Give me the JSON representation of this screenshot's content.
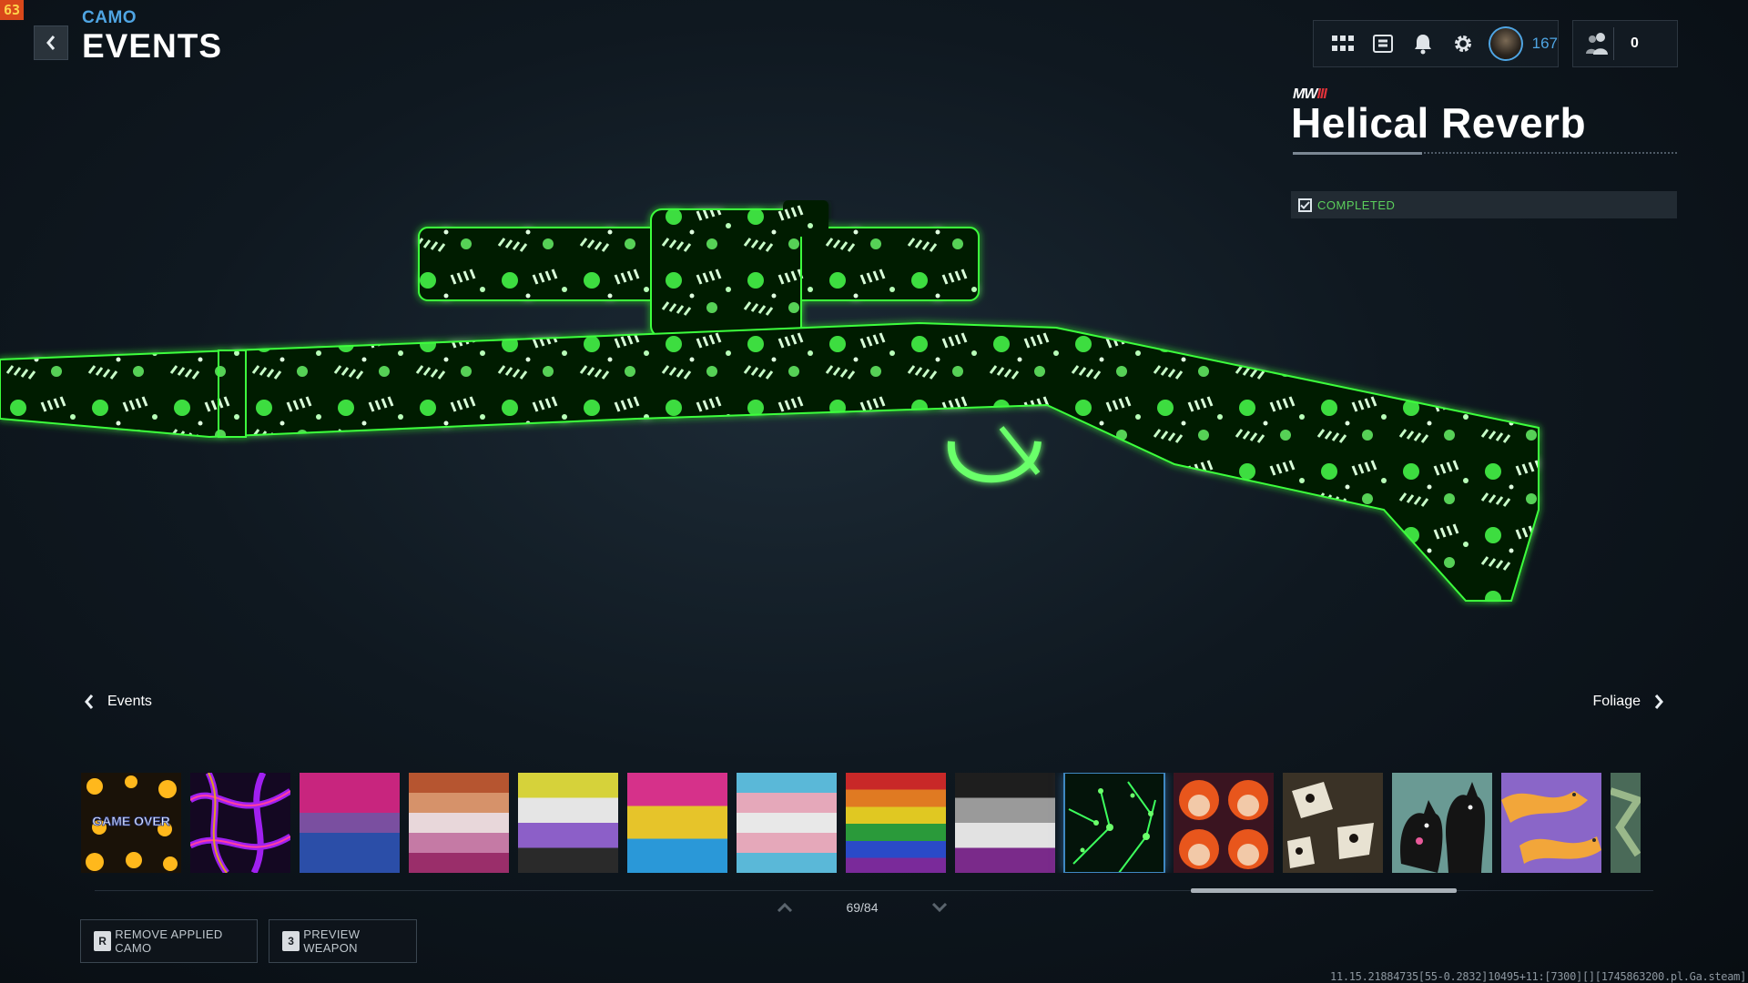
{
  "fps_counter": "63",
  "header": {
    "breadcrumb": "CAMO",
    "title": "EVENTS",
    "back_icon": "chevron-left-icon"
  },
  "topbar": {
    "icons": [
      "grid-menu-icon",
      "codex-icon",
      "bell-icon",
      "gear-icon"
    ],
    "player_level": "167",
    "party_count": "0"
  },
  "detail": {
    "game_logo": "MW",
    "game_logo_suffix": "III",
    "camo_name": "Helical Reverb",
    "status": "COMPLETED",
    "status_icon": "checkbox-checked-icon"
  },
  "category_nav": {
    "prev_label": "Events",
    "next_label": "Foliage"
  },
  "camo_grid": {
    "pager": "69/84",
    "selected_index": 9,
    "tiles": [
      {
        "id": "game-over",
        "game_over_text": "GAME OVER"
      },
      {
        "id": "purple-veins"
      },
      {
        "id": "bi-flag"
      },
      {
        "id": "lesbian-flag"
      },
      {
        "id": "nonbinary-flag"
      },
      {
        "id": "pan-flag"
      },
      {
        "id": "trans-flag"
      },
      {
        "id": "rainbow-flag"
      },
      {
        "id": "ace-flag"
      },
      {
        "id": "helical-reverb"
      },
      {
        "id": "orange-hair-anime"
      },
      {
        "id": "cow-dogs"
      },
      {
        "id": "black-cats"
      },
      {
        "id": "orange-cats"
      },
      {
        "id": "partial-green"
      }
    ]
  },
  "actions": [
    {
      "key": "R",
      "label": "REMOVE APPLIED CAMO"
    },
    {
      "key": "3",
      "label": "PREVIEW WEAPON"
    }
  ],
  "build_string": "11.15.21884735[55-0.2832]10495+11:[7300][][1745863200.pl.Ga.steam]",
  "colors": {
    "accent_blue": "#4fa5e3",
    "completed_green": "#5ccf5c",
    "camo_glow": "#4dff4d"
  }
}
